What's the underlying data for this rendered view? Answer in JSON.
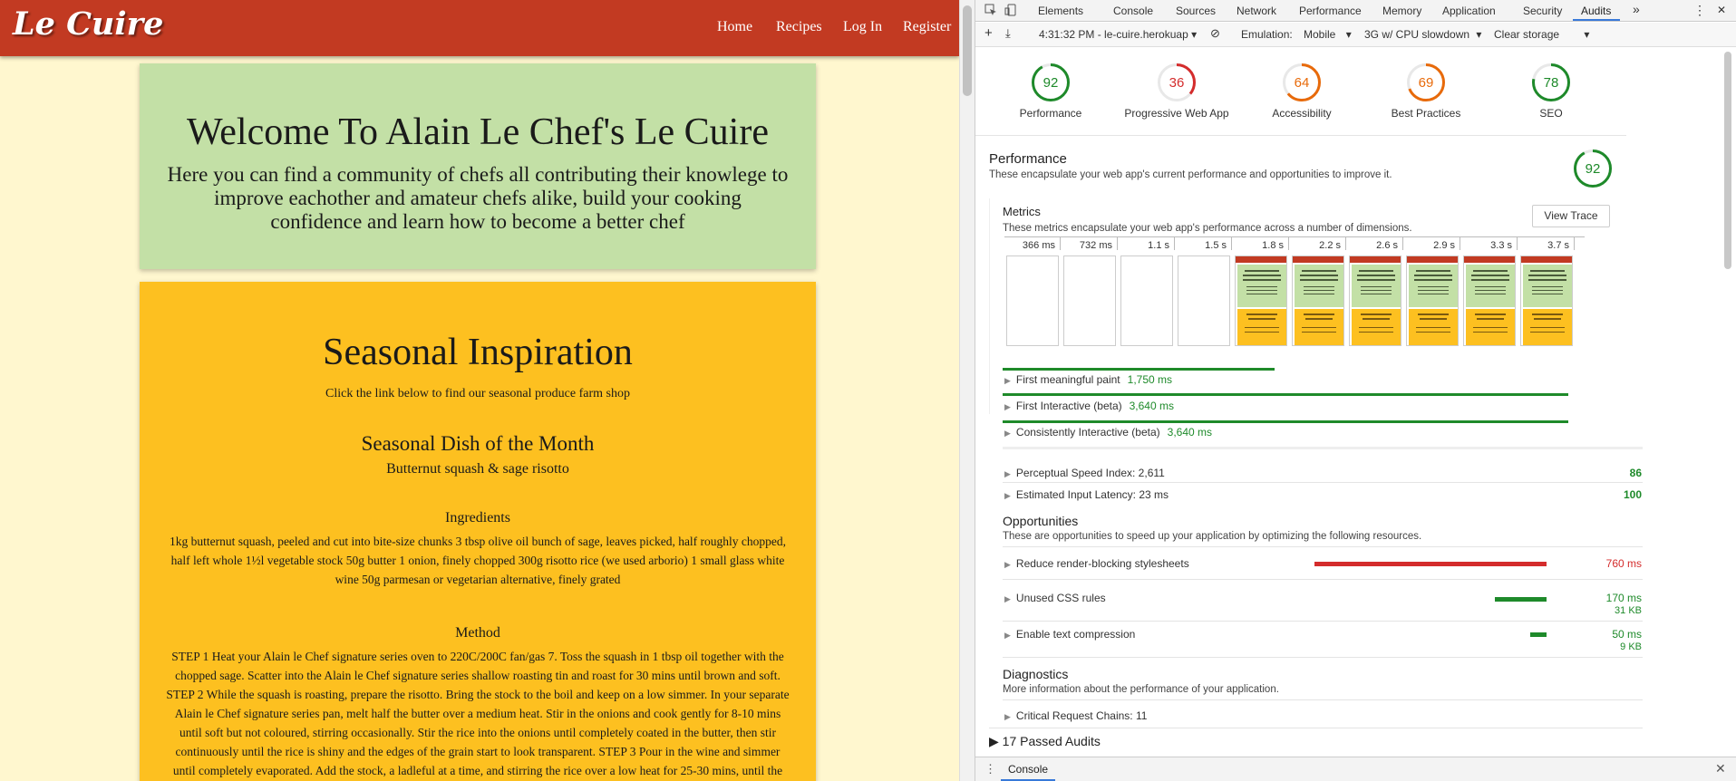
{
  "site": {
    "logo": "Le Cuire",
    "nav": [
      "Home",
      "Recipes",
      "Log In",
      "Register"
    ],
    "welcome_title": "Welcome To Alain Le Chef's Le Cuire",
    "welcome_text": "Here you can find a community of chefs all contributing their knowlege to improve eachother and amateur chefs alike, build your cooking confidence and learn how to become a better chef",
    "seasonal_title": "Seasonal Inspiration",
    "seasonal_sub": "Click the link below to find our seasonal produce farm shop",
    "dish_heading": "Seasonal Dish of the Month",
    "dish_name": "Butternut squash & sage risotto",
    "ingredients_heading": "Ingredients",
    "ingredients_text": "1kg butternut squash, peeled and cut into bite-size chunks 3 tbsp olive oil bunch of sage, leaves picked, half roughly chopped, half left whole 1½l vegetable stock 50g butter 1 onion, finely chopped 300g risotto rice (we used arborio) 1 small glass white wine 50g parmesan or vegetarian alternative, finely grated",
    "method_heading": "Method",
    "method_text": "STEP 1 Heat your Alain le Chef signature series oven to 220C/200C fan/gas 7. Toss the squash in 1 tbsp oil together with the chopped sage. Scatter into the Alain le Chef signature series shallow roasting tin and roast for 30 mins until brown and soft. STEP 2 While the squash is roasting, prepare the risotto. Bring the stock to the boil and keep on a low simmer. In your separate Alain le Chef signature series pan, melt half the butter over a medium heat. Stir in the onions and cook gently for 8-10 mins until soft but not coloured, stirring occasionally. Stir the rice into the onions until completely coated in the butter, then stir continuously until the rice is shiny and the edges of the grain start to look transparent. STEP 3 Pour in the wine and simmer until completely evaporated. Add the stock, a ladleful at a time, and stirring the rice over a low heat for 25-30 mins, until the"
  },
  "devtools": {
    "tabs": [
      "Elements",
      "Console",
      "Sources",
      "Network",
      "Performance",
      "Memory",
      "Application",
      "Security",
      "Audits"
    ],
    "active_tab": "Audits",
    "more_tabs": "»",
    "menu_dots": "⋮",
    "close": "✕",
    "toolbar": {
      "add": "+",
      "download": "⤓",
      "report": "4:31:32 PM - le-cuire.herokuap ▾",
      "clear_icon": "⊘",
      "emulation_label": "Emulation:",
      "emulation_value": "Mobile",
      "throttle_value": "3G w/ CPU slowdown",
      "clear_storage": "Clear storage"
    },
    "gauges": [
      {
        "score": 92,
        "label": "Performance",
        "color": "#1e8a2a",
        "fill": "#ffffff"
      },
      {
        "score": 36,
        "label": "Progressive Web App",
        "color": "#d42c2c",
        "fill": "#ffffff"
      },
      {
        "score": 64,
        "label": "Accessibility",
        "color": "#e86a0a",
        "fill": "#ffffff"
      },
      {
        "score": 69,
        "label": "Best Practices",
        "color": "#e86a0a",
        "fill": "#ffffff"
      },
      {
        "score": 78,
        "label": "SEO",
        "color": "#1e8a2a",
        "fill": "#ffffff"
      }
    ],
    "performance": {
      "title": "Performance",
      "desc": "These encapsulate your web app's current performance and opportunities to improve it.",
      "score": 92
    },
    "metrics": {
      "title": "Metrics",
      "desc": "These metrics encapsulate your web app's performance across a number of dimensions.",
      "view_trace": "View Trace",
      "frames": [
        "366 ms",
        "732 ms",
        "1.1 s",
        "1.5 s",
        "1.8 s",
        "2.2 s",
        "2.6 s",
        "2.9 s",
        "3.3 s",
        "3.7 s"
      ],
      "rows": [
        {
          "label": "First meaningful paint",
          "value": "1,750 ms",
          "ms": 1750
        },
        {
          "label": "First Interactive (beta)",
          "value": "3,640 ms",
          "ms": 3640
        },
        {
          "label": "Consistently Interactive (beta)",
          "value": "3,640 ms",
          "ms": 3640
        }
      ],
      "speed_index": {
        "label": "Perceptual Speed Index: 2,611",
        "score": "86"
      },
      "input_latency": {
        "label": "Estimated Input Latency: 23 ms",
        "score": "100"
      }
    },
    "opportunities": {
      "title": "Opportunities",
      "desc": "These are opportunities to speed up your application by optimizing the following resources.",
      "rows": [
        {
          "label": "Reduce render-blocking stylesheets",
          "value": "760 ms",
          "sub": "",
          "color": "#d42c2c",
          "ms": 760
        },
        {
          "label": "Unused CSS rules",
          "value": "170 ms",
          "sub": "31 KB",
          "color": "#1e8a2a",
          "ms": 170
        },
        {
          "label": "Enable text compression",
          "value": "50 ms",
          "sub": "9 KB",
          "color": "#1e8a2a",
          "ms": 50
        }
      ]
    },
    "diagnostics": {
      "title": "Diagnostics",
      "desc": "More information about the performance of your application.",
      "row": "Critical Request Chains: 11"
    },
    "passed": "▶ 17 Passed Audits",
    "drawer": {
      "menu": "⋮",
      "tab": "Console",
      "close": "✕"
    }
  }
}
